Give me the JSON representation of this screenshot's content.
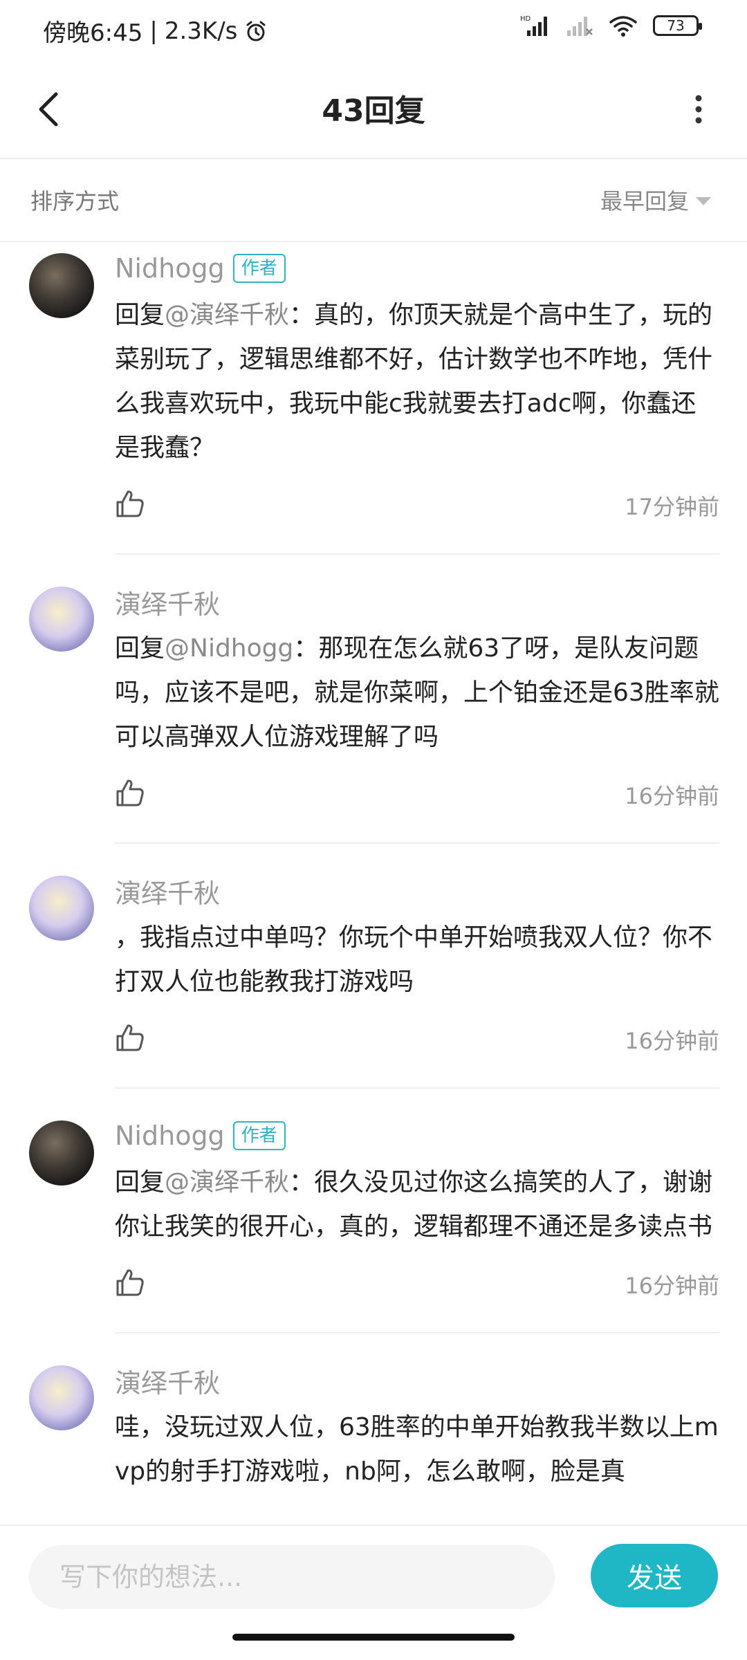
{
  "status_bar": {
    "time": "傍晚6:45",
    "net_speed": "2.3K/s",
    "separator": "|",
    "battery": "73",
    "icons": [
      "alarm-icon",
      "hd-signal-icon",
      "signal-icon",
      "wifi-icon",
      "battery-icon"
    ]
  },
  "nav": {
    "title": "43回复",
    "back_icon": "chevron-left-icon",
    "more_icon": "more-vertical-icon"
  },
  "sort": {
    "label": "排序方式",
    "selected": "最早回复"
  },
  "comments": [
    {
      "username": "Nidhogg",
      "badge": "作者",
      "reply_prefix": "回复",
      "mention": "@演绎千秋",
      "text": "：真的，你顶天就是个高中生了，玩的菜别玩了，逻辑思维都不好，估计数学也不咋地，凭什么我喜欢玩中，我玩中能c我就要去打adc啊，你蠢还是我蠢？",
      "time": "17分钟前"
    },
    {
      "username": "演绎千秋",
      "reply_prefix": "回复",
      "mention": "@Nidhogg",
      "text": "：那现在怎么就63了呀，是队友问题吗，应该不是吧，就是你菜啊，上个铂金还是63胜率就可以高弹双人位游戏理解了吗",
      "time": "16分钟前"
    },
    {
      "username": "演绎千秋",
      "text": "，我指点过中单吗？你玩个中单开始喷我双人位？你不打双人位也能教我打游戏吗",
      "time": "16分钟前"
    },
    {
      "username": "Nidhogg",
      "badge": "作者",
      "reply_prefix": "回复",
      "mention": "@演绎千秋",
      "text": "：很久没见过你这么搞笑的人了，谢谢你让我笑的很开心，真的，逻辑都理不通还是多读点书",
      "time": "16分钟前"
    },
    {
      "username": "演绎千秋",
      "text": "哇，没玩过双人位，63胜率的中单开始教我半数以上mvp的射手打游戏啦，nb阿，怎么敢啊，脸是真"
    }
  ],
  "input": {
    "placeholder": "写下你的想法...",
    "send_label": "发送"
  },
  "colors": {
    "accent": "#1fb7c6",
    "badge": "#2cb4c4",
    "muted_text": "#999999"
  }
}
